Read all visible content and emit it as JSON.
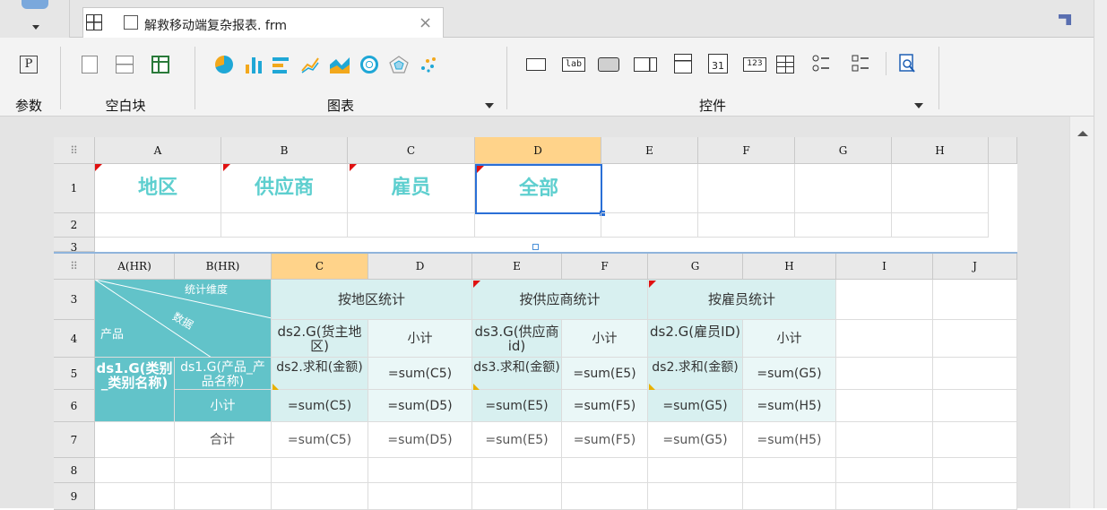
{
  "tab": {
    "filename": "解救移动端复杂报表. frm",
    "close": "×"
  },
  "ribbon": {
    "param_glyph": "P",
    "groups": [
      {
        "label": "参数"
      },
      {
        "label": "空白块"
      },
      {
        "label": "图表"
      },
      {
        "label": "控件"
      }
    ]
  },
  "sheet1": {
    "corner": "⠿",
    "columns": [
      "A",
      "B",
      "C",
      "D",
      "E",
      "F",
      "G",
      "H"
    ],
    "rows": [
      "1",
      "2",
      "3"
    ],
    "cells": {
      "a1": "地区",
      "b1": "供应商",
      "c1": "雇员",
      "d1": "全部"
    }
  },
  "sheet2": {
    "corner": "⠿",
    "columns": [
      "A(HR)",
      "B(HR)",
      "C",
      "D",
      "E",
      "F",
      "G",
      "H",
      "I",
      "J"
    ],
    "rows": [
      "3",
      "4",
      "5",
      "6",
      "7",
      "8",
      "9"
    ],
    "diag": {
      "top": "统计维度",
      "mid": "数据",
      "bottom": "产品"
    },
    "cells": {
      "c3": "按地区统计",
      "e3": "按供应商统计",
      "g3": "按雇员统计",
      "c4": "ds2.G(货主地区)",
      "d4": "小计",
      "e4": "ds3.G(供应商id)",
      "f4": "小计",
      "g4": "ds2.G(雇员ID)",
      "h4": "小计",
      "a5": "ds1.G(类别_类别名称)",
      "b5": "ds1.G(产品_产品名称)",
      "c5": "ds2.求和(金额)",
      "d5": "=sum(C5)",
      "e5": "ds3.求和(金额)",
      "f5": "=sum(E5)",
      "g5": "ds2.求和(金额)",
      "h5": "=sum(G5)",
      "b6": "小计",
      "c6": "=sum(C5)",
      "d6": "=sum(D5)",
      "e6": "=sum(E5)",
      "f6": "=sum(F5)",
      "g6": "=sum(G5)",
      "h6": "=sum(H5)",
      "b7": "合计",
      "c7": "=sum(C5)",
      "d7": "=sum(D5)",
      "e7": "=sum(E5)",
      "f7": "=sum(F5)",
      "g7": "=sum(G5)",
      "h7": "=sum(H5)"
    }
  },
  "colors": {
    "teal_dark": "#62c3c9",
    "teal_light": "#d8f0f0",
    "teal_pale": "#eaf7f7",
    "accent_text": "#5ecfcf",
    "select_border": "#2a6fd6",
    "header_selected": "#ffd38a"
  }
}
